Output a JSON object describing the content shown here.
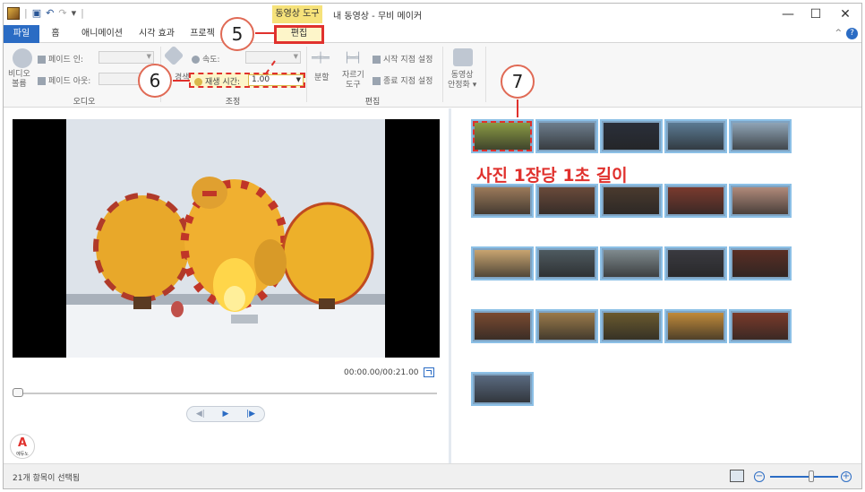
{
  "window": {
    "doc_title": "내 동영상 - 무비 메이커",
    "context_tab_header": "동영상 도구",
    "controls": {
      "minimize": "—",
      "maximize": "☐",
      "close": "✕"
    },
    "qat_icons": [
      "app-icon",
      "save-icon",
      "undo-icon",
      "redo-icon",
      "customize-icon"
    ]
  },
  "ribbon_tabs": {
    "file": "파일",
    "home": "홈",
    "animation": "애니메이션",
    "visual_effects": "시각 효과",
    "project": "프로젝",
    "edit": "편집",
    "collapse": "^",
    "help": "?"
  },
  "ribbon": {
    "audio": {
      "video_volume": "비디오\n볼륨",
      "fade_in": "페이드 인:",
      "fade_out": "페이드 아웃:",
      "label": "오디오"
    },
    "adjust": {
      "bg_color": "경색",
      "speed": "속도:",
      "duration_label": "재생 시간:",
      "duration_value": "1.00",
      "label": "조정"
    },
    "edit": {
      "split": "분할",
      "trim_tool": "자르기\n도구",
      "set_start": "시작 지점 설정",
      "set_end": "종료 지점 설정",
      "label": "편집"
    },
    "stabilize": {
      "label": "동영상\n안정화 ▾"
    }
  },
  "preview": {
    "timecode": "00:00.00/00:21.00",
    "progress": 0.0
  },
  "storyboard": {
    "caption": "사진 1장당 1초 길이",
    "selected_index": 0,
    "item_count": 21
  },
  "annotations": {
    "callout_5": "5",
    "callout_6": "6",
    "callout_7": "7"
  },
  "status": {
    "text": "21개 항목이 선택됨",
    "zoom_out": "−",
    "zoom_in": "+",
    "zoom_level": 0.6
  },
  "watermark": {
    "logo": "A",
    "sub": "에듀노"
  },
  "colors": {
    "accent": "#2b6cc4",
    "highlight": "#e0312d",
    "context_tab": "#f6e27a"
  }
}
